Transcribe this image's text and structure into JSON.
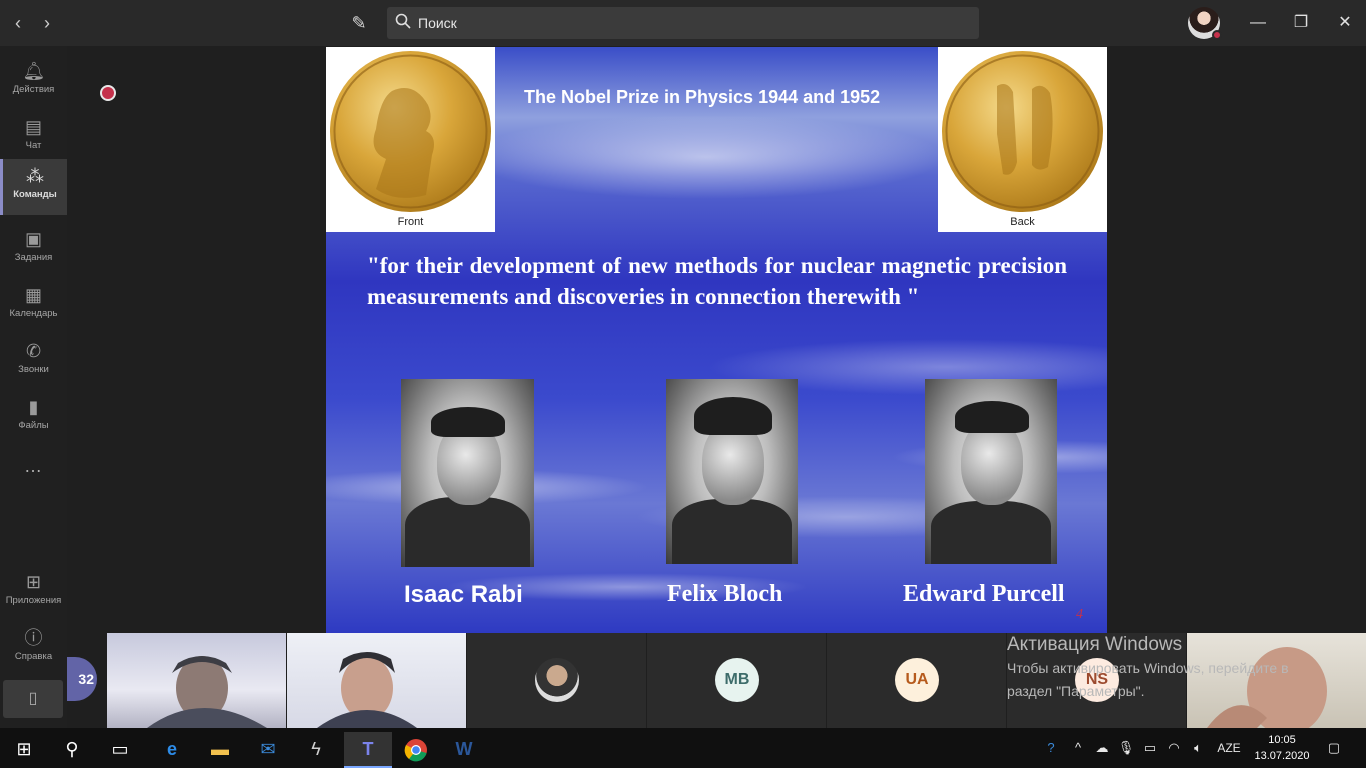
{
  "search": {
    "placeholder": "Поиск"
  },
  "sidebar": {
    "items": [
      {
        "label": "Действия",
        "icon": "bell-icon"
      },
      {
        "label": "Чат",
        "icon": "chat-icon"
      },
      {
        "label": "Команды",
        "icon": "teams-icon",
        "active": true
      },
      {
        "label": "Задания",
        "icon": "assignments-icon"
      },
      {
        "label": "Календарь",
        "icon": "calendar-icon"
      },
      {
        "label": "Звонки",
        "icon": "phone-icon"
      },
      {
        "label": "Файлы",
        "icon": "file-icon"
      }
    ],
    "more": "…",
    "bottom": [
      {
        "label": "Приложения",
        "icon": "apps-icon"
      },
      {
        "label": "Справка",
        "icon": "help-icon"
      }
    ]
  },
  "slide": {
    "title": "The Nobel Prize in Physics 1944 and 1952",
    "medal_front_caption": "Front",
    "medal_back_caption": "Back",
    "quote": "\"for their development of new methods for nuclear magnetic precision measurements and discoveries in connection therewith \"",
    "laureates": [
      "Isaac Rabi",
      "Felix Bloch",
      "Edward Purcell"
    ],
    "page_number": "4"
  },
  "participants": {
    "count_badge": "32",
    "initials": [
      {
        "text": "MB",
        "bg": "#e7f3ef",
        "fg": "#3d6c6a"
      },
      {
        "text": "UA",
        "bg": "#fdf0dc",
        "fg": "#b65a1c"
      },
      {
        "text": "NS",
        "bg": "#fdebe0",
        "fg": "#9c4a2e"
      }
    ]
  },
  "activation": {
    "title": "Активация Windows",
    "line1": "Чтобы активировать Windows, перейдите в",
    "line2": "раздел \"Параметры\"."
  },
  "taskbar": {
    "language": "AZE",
    "time": "10:05",
    "date": "13.07.2020"
  },
  "colors": {
    "accent": "#6264a7",
    "alert": "#c4314b",
    "taskbar": "#101010"
  }
}
